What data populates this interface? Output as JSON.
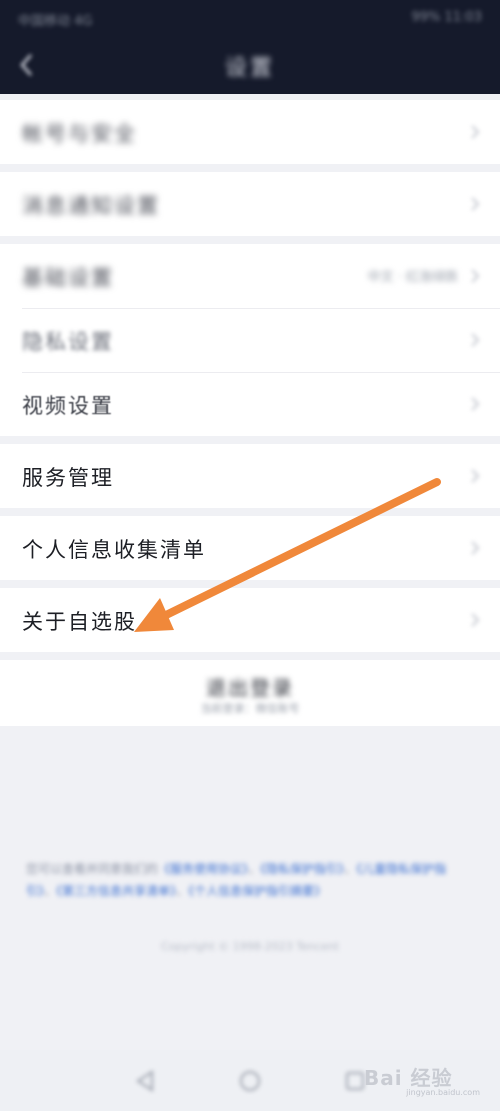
{
  "status_bar": {
    "carrier": "中国移动 4G",
    "right": "99% 11:03"
  },
  "nav": {
    "title": "设置"
  },
  "settings": {
    "rows": [
      {
        "label": "帐号与安全"
      },
      {
        "label": "消息通知设置"
      },
      {
        "label": "基础设置",
        "value": "中文 · 红涨绿跌"
      },
      {
        "label": "隐私设置"
      },
      {
        "label": "视频设置"
      },
      {
        "label": "服务管理"
      },
      {
        "label": "个人信息收集清单"
      },
      {
        "label": "关于自选股"
      }
    ]
  },
  "logout": {
    "title": "退出登录",
    "subtitle": "当前登录：微信账号"
  },
  "legal": {
    "prefix": "您可以查看并同意我们的",
    "link1": "《服务使用协议》",
    "link2": "《隐私保护指引》",
    "link3": "《儿童隐私保护指引》",
    "link4": "《第三方信息共享清单》",
    "link5": "《个人信息保护指引摘要》"
  },
  "copyright": "Copyright © 1998-2023 Tencent",
  "watermark": {
    "text": "Bai 经验",
    "url": "jingyan.baidu.com"
  },
  "colors": {
    "nav_bg": "#151a2b",
    "page_bg": "#f0f1f5",
    "arrow": "#f0883a",
    "link": "#3b6fd1"
  }
}
